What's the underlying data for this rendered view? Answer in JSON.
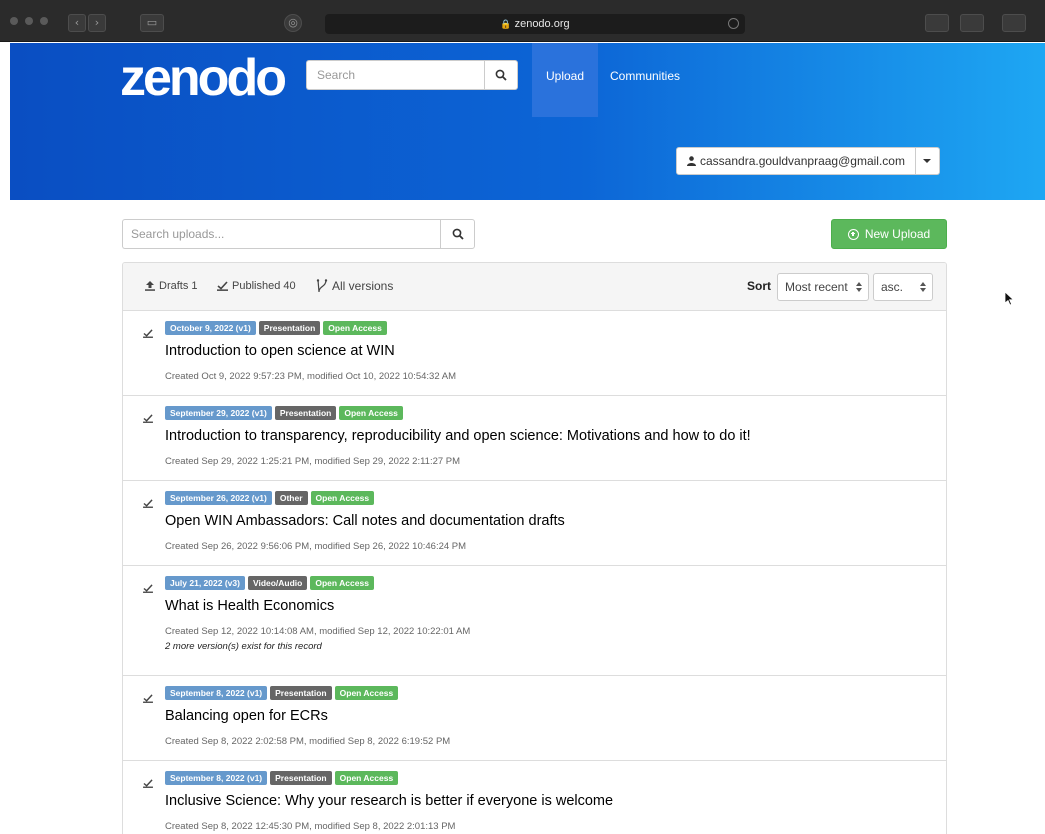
{
  "browser": {
    "url": "zenodo.org"
  },
  "header": {
    "logo": "zenodo",
    "search_placeholder": "Search",
    "nav": {
      "upload": "Upload",
      "communities": "Communities"
    },
    "user_email": "cassandra.gouldvanpraag@gmail.com"
  },
  "toolbar": {
    "search_placeholder": "Search uploads...",
    "new_upload": "New Upload"
  },
  "filters": {
    "drafts": "Drafts 1",
    "published": "Published 40",
    "versions": "All versions"
  },
  "sort": {
    "label": "Sort",
    "field": "Most recent",
    "order": "asc."
  },
  "records": [
    {
      "date": "October 9, 2022 (v1)",
      "type": "Presentation",
      "access": "Open Access",
      "title": "Introduction to open science at WIN",
      "meta": "Created Oct 9, 2022 9:57:23 PM, modified Oct 10, 2022 10:54:32 AM",
      "note": ""
    },
    {
      "date": "September 29, 2022 (v1)",
      "type": "Presentation",
      "access": "Open Access",
      "title": "Introduction to transparency, reproducibility and open science: Motivations and how to do it!",
      "meta": "Created Sep 29, 2022 1:25:21 PM, modified Sep 29, 2022 2:11:27 PM",
      "note": ""
    },
    {
      "date": "September 26, 2022 (v1)",
      "type": "Other",
      "access": "Open Access",
      "title": "Open WIN Ambassadors: Call notes and documentation drafts",
      "meta": "Created Sep 26, 2022 9:56:06 PM, modified Sep 26, 2022 10:46:24 PM",
      "note": ""
    },
    {
      "date": "July 21, 2022 (v3)",
      "type": "Video/Audio",
      "access": "Open Access",
      "title": "What is Health Economics",
      "meta": "Created Sep 12, 2022 10:14:08 AM, modified Sep 12, 2022 10:22:01 AM",
      "note": "2 more version(s) exist for this record"
    },
    {
      "date": "September 8, 2022 (v1)",
      "type": "Presentation",
      "access": "Open Access",
      "title": "Balancing open for ECRs",
      "meta": "Created Sep 8, 2022 2:02:58 PM, modified Sep 8, 2022 6:19:52 PM",
      "note": ""
    },
    {
      "date": "September 8, 2022 (v1)",
      "type": "Presentation",
      "access": "Open Access",
      "title": "Inclusive Science: Why your research is better if everyone is welcome",
      "meta": "Created Sep 8, 2022 12:45:30 PM, modified Sep 8, 2022 2:01:13 PM",
      "note": ""
    }
  ],
  "colors": {
    "header_start": "#0a4ec2",
    "header_end": "#1ea7f3",
    "date_badge": "#6699cc",
    "type_badge": "#666666",
    "access_badge": "#5cb85c",
    "new_upload": "#5cb85c"
  }
}
